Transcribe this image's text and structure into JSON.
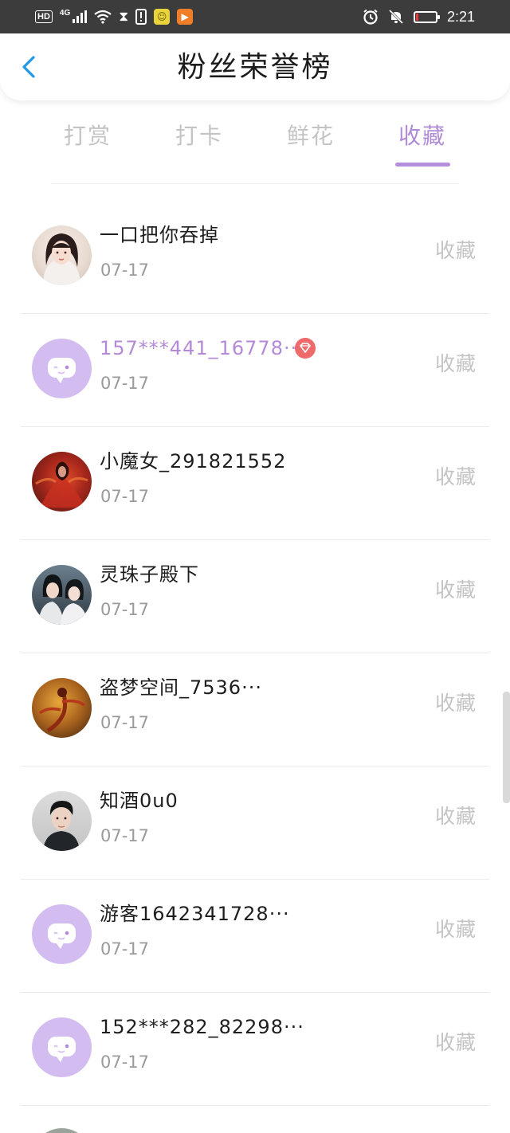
{
  "status_bar": {
    "hd": "HD",
    "network": "4G",
    "time": "2:21",
    "icons": [
      "signal-icon",
      "wifi-icon",
      "hourglass-icon",
      "alert-icon",
      "sun-app-icon",
      "play-app-icon",
      "alarm-icon",
      "mute-icon",
      "battery-icon"
    ]
  },
  "header": {
    "title": "粉丝荣誉榜",
    "back_icon": "chevron-left-icon"
  },
  "tabs": [
    {
      "label": "打赏",
      "active": false
    },
    {
      "label": "打卡",
      "active": false
    },
    {
      "label": "鲜花",
      "active": false
    },
    {
      "label": "收藏",
      "active": true
    }
  ],
  "colors": {
    "accent": "#b58fde",
    "default_avatar_bg": "#d3bdf0",
    "gem_badge": "#ee6b6b"
  },
  "fans": [
    {
      "name": "一口把你吞掉",
      "date": "07-17",
      "action": "收藏",
      "avatar": "photo-girl-ancient"
    },
    {
      "name": "157***441_16778···",
      "date": "07-17",
      "action": "收藏",
      "avatar": "default-chat-avatar",
      "vip_badge": "gem-icon"
    },
    {
      "name": "小魔女_291821552",
      "date": "07-17",
      "action": "收藏",
      "avatar": "photo-red-dancer"
    },
    {
      "name": "灵珠子殿下",
      "date": "07-17",
      "action": "收藏",
      "avatar": "photo-couple"
    },
    {
      "name": "盗梦空间_7536···",
      "date": "07-17",
      "action": "收藏",
      "avatar": "photo-golden-figure"
    },
    {
      "name": "知酒0u0",
      "date": "07-17",
      "action": "收藏",
      "avatar": "photo-man-portrait"
    },
    {
      "name": "游客1642341728···",
      "date": "07-17",
      "action": "收藏",
      "avatar": "default-chat-avatar"
    },
    {
      "name": "152***282_82298···",
      "date": "07-17",
      "action": "收藏",
      "avatar": "default-chat-avatar"
    }
  ]
}
